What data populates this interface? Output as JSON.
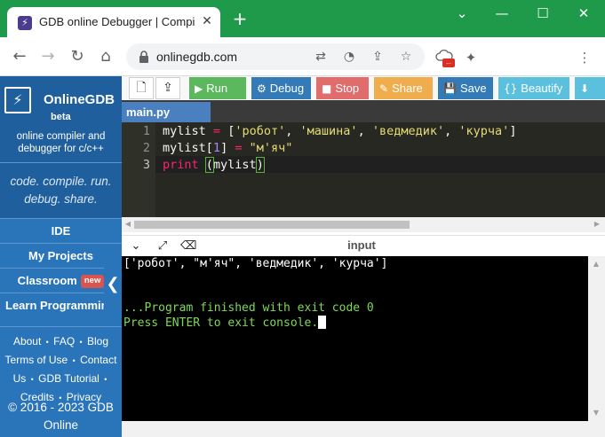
{
  "browser": {
    "tab_title": "GDB online Debugger | Compile",
    "tab_favicon": "⚡",
    "tab_close": "✕",
    "new_tab": "+",
    "window_controls": {
      "minimize": "—",
      "maximize": "☐",
      "close": "✕",
      "dropdown": "⌄"
    },
    "nav": {
      "back": "←",
      "forward": "→",
      "reload": "↻",
      "home": "⌂"
    },
    "url": "onlinegdb.com",
    "omnibox_icons": [
      "translate-icon",
      "performance-icon",
      "share-icon",
      "bookmark-star-icon"
    ],
    "omnibox_glyphs": [
      "⇄",
      "◔",
      "⇪",
      "☆"
    ],
    "extensions": {
      "puzzle": "✦",
      "menu": "⋮",
      "badge": "..."
    },
    "accent": "#1e9a4a"
  },
  "sidebar": {
    "brand_logo": "⚡",
    "brand_name": "OnlineGDB",
    "brand_beta": "beta",
    "desc_line1": "online compiler and",
    "desc_line2": "debugger for c/c++",
    "tagline_line1": "code. compile. run.",
    "tagline_line2": "debug. share.",
    "items": [
      {
        "label": "IDE"
      },
      {
        "label": "My Projects"
      },
      {
        "label": "Classroom",
        "badge": "new"
      },
      {
        "label": "Learn Programming"
      }
    ],
    "footer_links": [
      "About",
      "FAQ",
      "Blog",
      "Terms of Use",
      "Contact",
      "Us",
      "GDB Tutorial",
      "Credits",
      "Privacy"
    ],
    "separator": "•",
    "copyright_line1": "© 2016 - 2023 GDB",
    "copyright_line2": "Online",
    "collapse_glyph": "❮",
    "color": "#2a74b9"
  },
  "toolbar": {
    "new_file_glyph": "🗋",
    "upload_glyph": "⇪",
    "run": {
      "icon": "▶",
      "label": "Run",
      "color": "#5cb85c"
    },
    "debug": {
      "icon": "⚙",
      "label": "Debug",
      "color": "#337ab7"
    },
    "stop": {
      "icon": "■",
      "label": "Stop",
      "color": "#e06c6c"
    },
    "share": {
      "icon": "✎",
      "label": "Share",
      "color": "#f0ad4e"
    },
    "save": {
      "icon": "💾",
      "label": "Save",
      "color": "#337ab7"
    },
    "beautify": {
      "icon": "{}",
      "label": "Beautify",
      "color": "#5bc0de"
    },
    "download": {
      "icon": "⬇",
      "color": "#5bc0de"
    }
  },
  "editor": {
    "tab": "main.py",
    "line_numbers": [
      "1",
      "2",
      "3"
    ],
    "code": {
      "l1_var": "mylist",
      "l1_eq": "=",
      "l1_open": "[",
      "l1_s1": "'робот'",
      "l1_s2": "'машина'",
      "l1_s3": "'ведмедик'",
      "l1_s4": "'курча'",
      "l1_close": "]",
      "l2_var": "mylist",
      "l2_idx_open": "[",
      "l2_idx": "1",
      "l2_idx_close": "]",
      "l2_eq": "=",
      "l2_str": "\"м'яч\"",
      "l3_kw": "print",
      "l3_open": "(",
      "l3_arg": "mylist",
      "l3_close": ")"
    },
    "comma": ",",
    "background": "#272822"
  },
  "console": {
    "title": "input",
    "icons": {
      "collapse": "⌄",
      "expand": "⤢",
      "clear": "⌫"
    },
    "output_line": "['робот', \"м'яч\", 'ведмедик', 'курча']",
    "finish_line": "...Program finished with exit code 0",
    "press_line": "Press ENTER to exit console.",
    "scroll_up": "▲",
    "scroll_down": "▼",
    "scroll_left": "◀",
    "scroll_right": "▶"
  }
}
